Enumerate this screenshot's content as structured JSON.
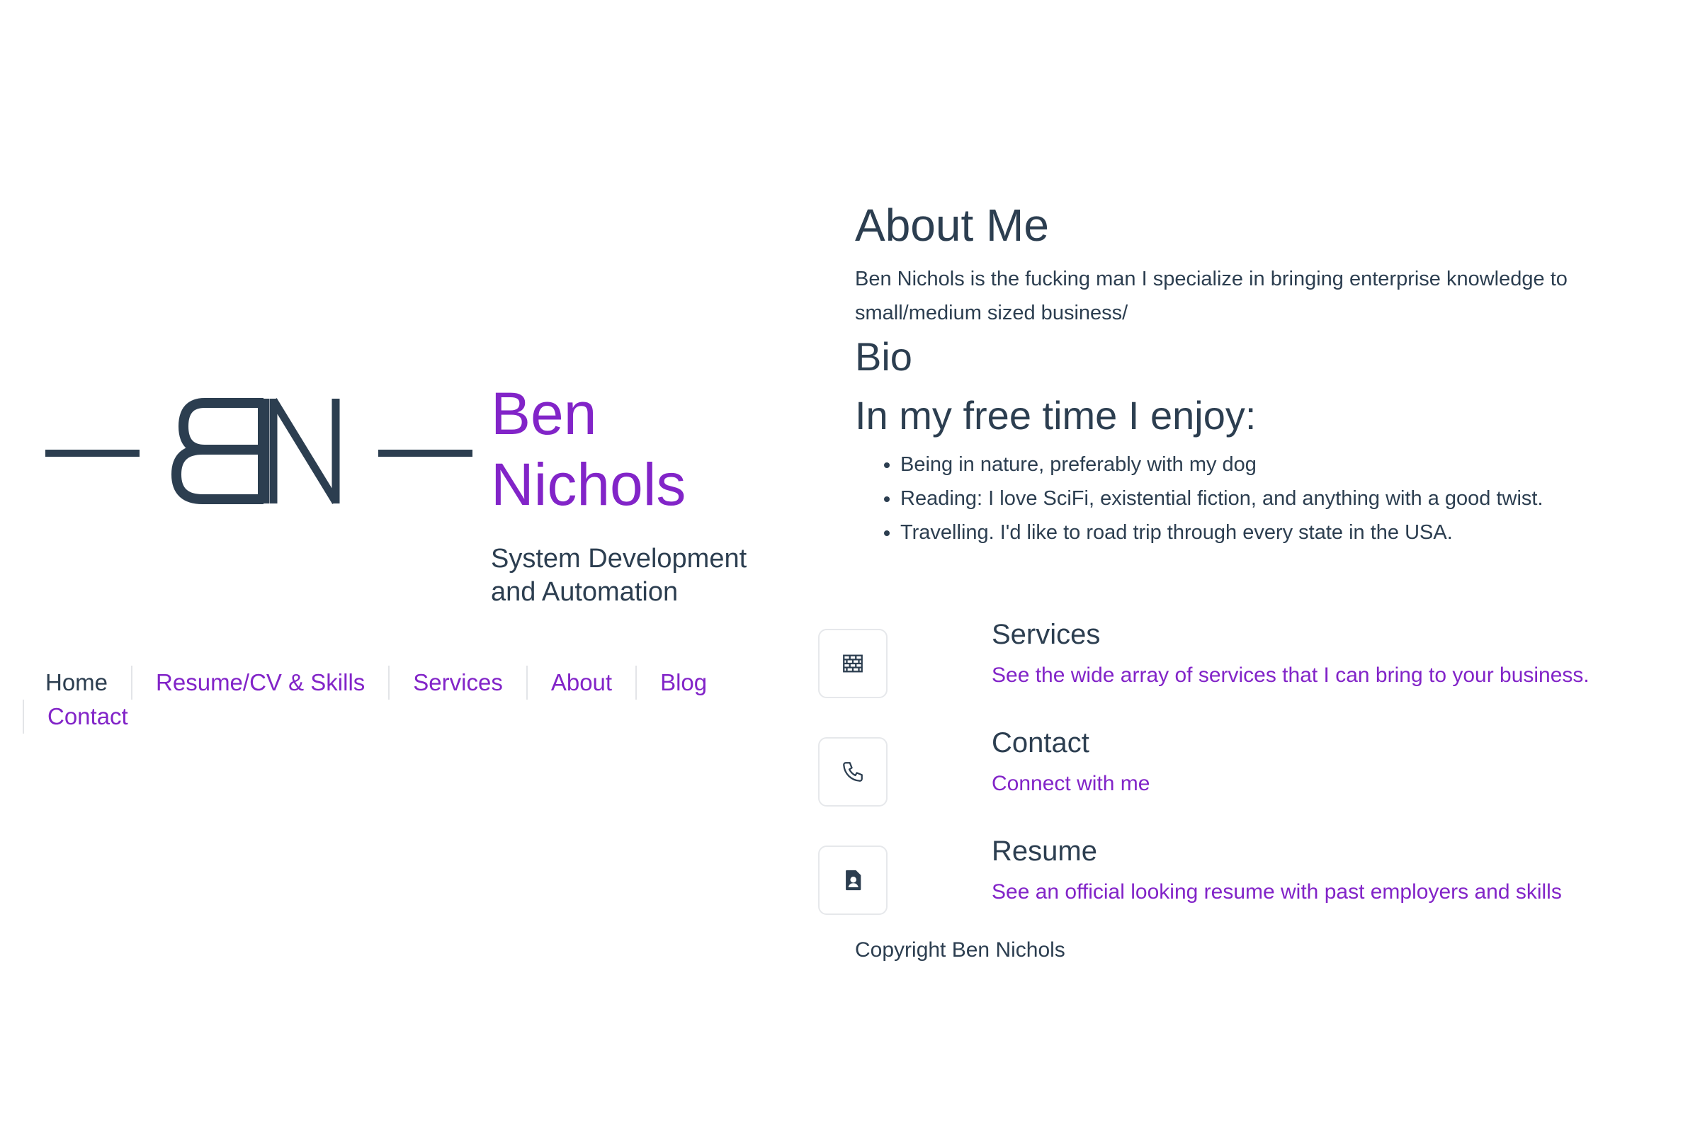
{
  "colors": {
    "accent": "#8224c8",
    "text": "#2c3e50",
    "border": "#e6e8eb"
  },
  "logo": {
    "monogram": "BN",
    "icon": "bn-monogram-logo"
  },
  "brand": {
    "name_line1": "Ben",
    "name_line2": "Nichols",
    "tagline_line1": "System Development",
    "tagline_line2": "and Automation"
  },
  "nav": {
    "items": [
      {
        "label": "Home",
        "current": true
      },
      {
        "label": "Resume/CV & Skills"
      },
      {
        "label": "Services"
      },
      {
        "label": "About"
      },
      {
        "label": "Blog"
      },
      {
        "label": "Contact"
      }
    ]
  },
  "about": {
    "heading": "About Me",
    "intro": "Ben Nichols is the fucking man I specialize in bringing enterprise knowledge to small/medium sized business/",
    "bio_heading": "Bio",
    "free_time_heading": "In my free time I enjoy:",
    "hobbies": [
      "Being in nature, preferably with my dog",
      "Reading: I love SciFi, existential fiction, and anything with a good twist.",
      "Travelling. I'd like to road trip through every state in the USA."
    ]
  },
  "cards": [
    {
      "icon": "brick-wall-icon",
      "title": "Services",
      "link": "See the wide array of services that I can bring to your business."
    },
    {
      "icon": "phone-icon",
      "title": "Contact",
      "link": "Connect with me"
    },
    {
      "icon": "resume-file-icon",
      "title": "Resume",
      "link": "See an official looking resume with past employers and skills"
    }
  ],
  "footer": {
    "copyright": "Copyright Ben Nichols"
  }
}
